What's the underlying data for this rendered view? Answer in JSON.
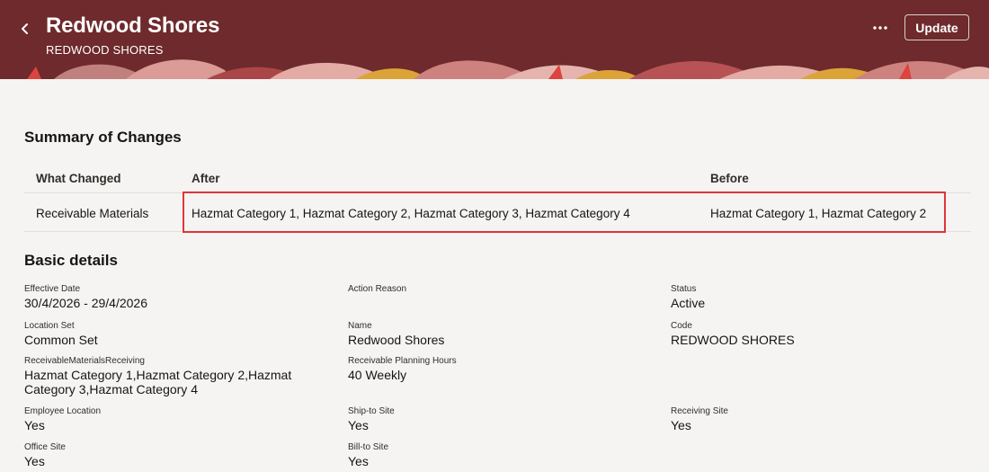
{
  "header": {
    "title": "Redwood Shores",
    "subtitle": "REDWOOD SHORES",
    "update_label": "Update",
    "back_icon": "chevron-left-icon",
    "more_icon": "more-horizontal-icon",
    "background_color": "#6e2a2c"
  },
  "summary": {
    "title": "Summary of Changes",
    "columns": [
      "What Changed",
      "After",
      "Before"
    ],
    "rows": [
      {
        "what": "Receivable Materials",
        "after": "Hazmat Category 1, Hazmat Category 2, Hazmat Category 3, Hazmat Category 4",
        "before": "Hazmat Category 1, Hazmat Category 2"
      }
    ],
    "highlight_color": "#e0343a"
  },
  "basic": {
    "title": "Basic details",
    "fields": {
      "effective_date": {
        "label": "Effective Date",
        "value": "30/4/2026 - 29/4/2026"
      },
      "action_reason": {
        "label": "Action Reason",
        "value": ""
      },
      "status": {
        "label": "Status",
        "value": "Active"
      },
      "location_set": {
        "label": "Location Set",
        "value": "Common Set"
      },
      "name": {
        "label": "Name",
        "value": "Redwood Shores"
      },
      "code": {
        "label": "Code",
        "value": "REDWOOD SHORES"
      },
      "receivable_materials": {
        "label": "ReceivableMaterialsReceiving",
        "value": "Hazmat Category 1,Hazmat Category 2,Hazmat Category 3,Hazmat Category 4"
      },
      "planning_hours": {
        "label": "Receivable Planning Hours",
        "value": "40 Weekly"
      },
      "employee_location": {
        "label": "Employee Location",
        "value": "Yes"
      },
      "ship_to_site": {
        "label": "Ship-to Site",
        "value": "Yes"
      },
      "receiving_site": {
        "label": "Receiving Site",
        "value": "Yes"
      },
      "office_site": {
        "label": "Office Site",
        "value": "Yes"
      },
      "bill_to_site": {
        "label": "Bill-to Site",
        "value": "Yes"
      }
    }
  }
}
